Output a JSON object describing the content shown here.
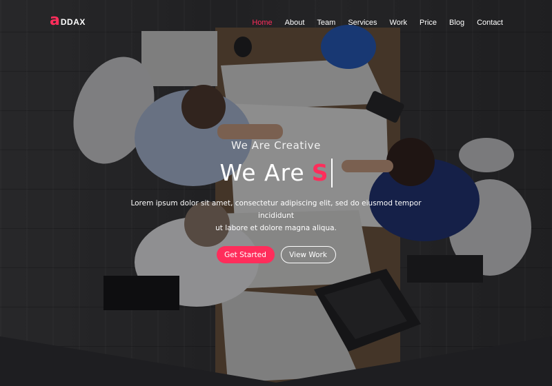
{
  "brand": {
    "logo_mark": "a",
    "logo_text": "DDAX",
    "accent_color": "#ff2d5b"
  },
  "nav": {
    "items": [
      {
        "label": "Home",
        "active": true
      },
      {
        "label": "About",
        "active": false
      },
      {
        "label": "Team",
        "active": false
      },
      {
        "label": "Services",
        "active": false
      },
      {
        "label": "Work",
        "active": false
      },
      {
        "label": "Price",
        "active": false
      },
      {
        "label": "Blog",
        "active": false
      },
      {
        "label": "Contact",
        "active": false
      }
    ]
  },
  "hero": {
    "subtitle": "We Are Creative",
    "headline_static": "We Are",
    "headline_typed": "S",
    "description_line1": "Lorem ipsum dolor sit amet, consectetur adipiscing elit, sed do eiusmod tempor incididunt",
    "description_line2": "ut labore et dolore magna aliqua.",
    "primary_button": "Get Started",
    "secondary_button": "View Work"
  }
}
